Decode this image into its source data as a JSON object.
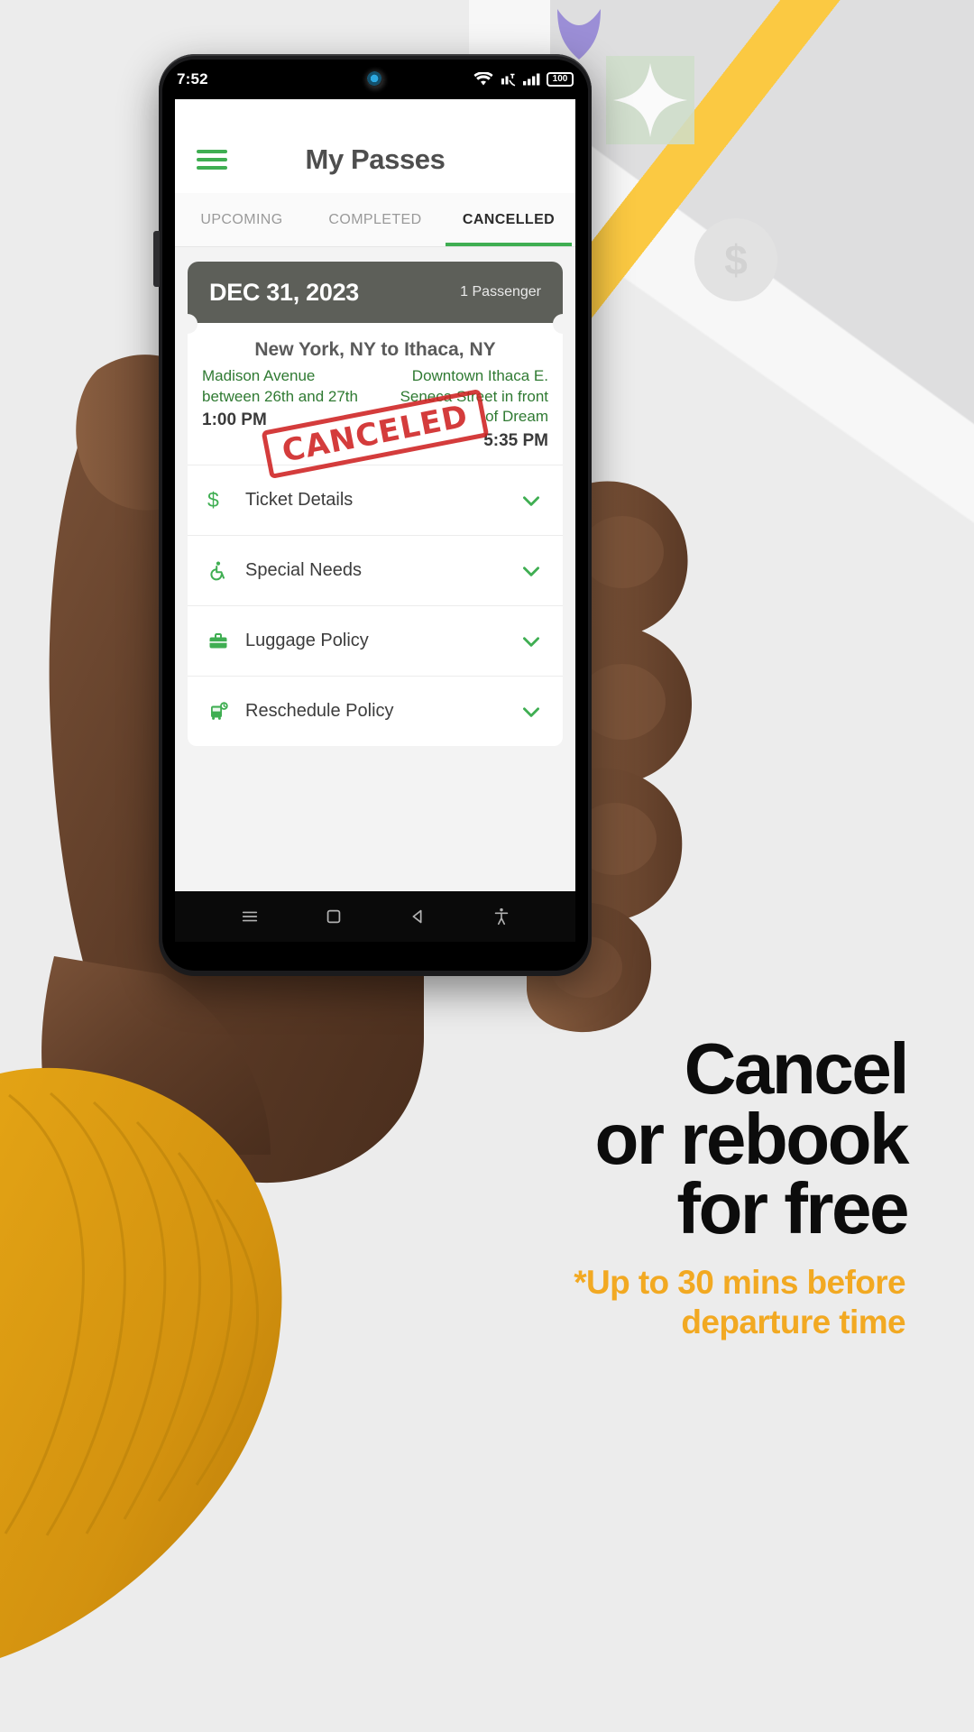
{
  "phone": {
    "status_bar": {
      "time": "7:52",
      "icons": [
        "wifi-icon",
        "call-signal-icon",
        "cellular-signal-icon"
      ],
      "battery_level": "100"
    },
    "app_bar": {
      "menu_icon": "hamburger-menu-icon",
      "title": "My Passes"
    },
    "tabs": [
      {
        "label": "UPCOMING",
        "active": false
      },
      {
        "label": "COMPLETED",
        "active": false
      },
      {
        "label": "CANCELLED",
        "active": true
      }
    ],
    "ticket": {
      "date": "DEC 31, 2023",
      "passengers": "1 Passenger",
      "route_title": "New York, NY to Ithaca, NY",
      "stamp": "CANCELED",
      "from": {
        "address": "Madison Avenue between 26th and 27th",
        "time": "1:00 PM"
      },
      "to": {
        "address": "Downtown Ithaca E. Seneca Street in front of Dream",
        "time": "5:35 PM"
      }
    },
    "accordion": [
      {
        "icon": "dollar-icon",
        "label": "Ticket Details",
        "chevron": "chevron-down-icon"
      },
      {
        "icon": "wheelchair-icon",
        "label": "Special Needs",
        "chevron": "chevron-down-icon"
      },
      {
        "icon": "briefcase-icon",
        "label": "Luggage Policy",
        "chevron": "chevron-down-icon"
      },
      {
        "icon": "bus-clock-icon",
        "label": "Reschedule Policy",
        "chevron": "chevron-down-icon"
      }
    ],
    "nav_bar": {
      "recents_icon": "recents-icon",
      "home_icon": "home-square-icon",
      "back_icon": "back-triangle-icon",
      "accessibility_icon": "accessibility-icon"
    }
  },
  "marketing": {
    "headline_lines": [
      "Cancel",
      "or rebook",
      "for free"
    ],
    "subline_lines": [
      "*Up to 30 mins before",
      "departure time"
    ]
  },
  "colors": {
    "brand_green": "#3fae52",
    "accent_orange": "#f2a922",
    "stamp_red": "#cf2222",
    "ticket_header": "#5d5f59",
    "page_bg": "#ececec"
  }
}
